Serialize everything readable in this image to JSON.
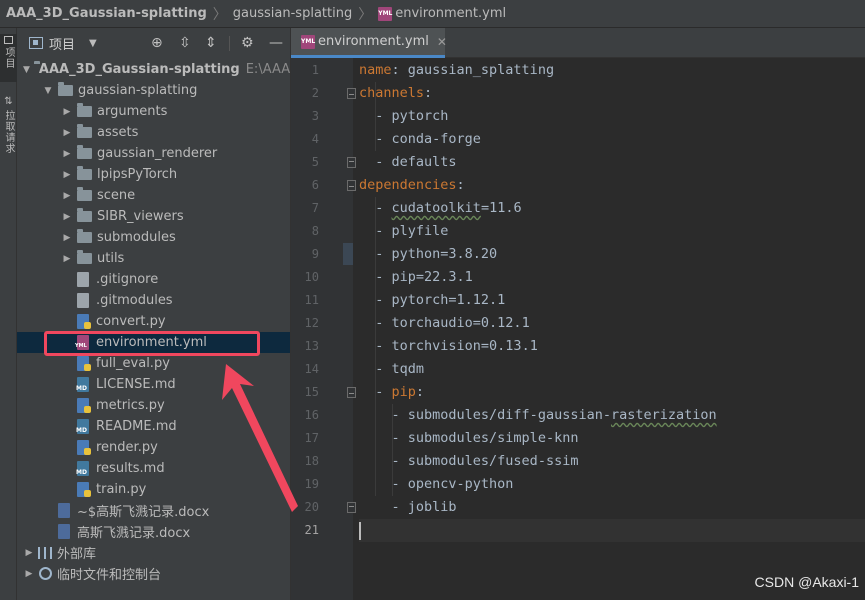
{
  "breadcrumb": {
    "root": "AAA_3D_Gaussian-splatting",
    "folder": "gaussian-splatting",
    "file": "environment.yml",
    "file_badge": "YML"
  },
  "toolstrip": {
    "project_tab": "项目",
    "pull_requests_tab": "拉取请求"
  },
  "project_panel": {
    "title": "项目",
    "toolbar_icons": [
      "target-icon",
      "expand-all-icon",
      "collapse-all-icon",
      "settings-icon",
      "hide-icon"
    ],
    "tree": [
      {
        "label": "AAA_3D_Gaussian-splatting",
        "hint": "E:\\AAA_",
        "type": "folder",
        "level": 0,
        "expanded": true
      },
      {
        "label": "gaussian-splatting",
        "type": "folder",
        "level": 1,
        "expanded": true
      },
      {
        "label": "arguments",
        "type": "folder",
        "level": 2
      },
      {
        "label": "assets",
        "type": "folder",
        "level": 2
      },
      {
        "label": "gaussian_renderer",
        "type": "folder",
        "level": 2
      },
      {
        "label": "lpipsPyTorch",
        "type": "folder",
        "level": 2
      },
      {
        "label": "scene",
        "type": "folder",
        "level": 2
      },
      {
        "label": "SIBR_viewers",
        "type": "folder",
        "level": 2
      },
      {
        "label": "submodules",
        "type": "folder",
        "level": 2
      },
      {
        "label": "utils",
        "type": "folder",
        "level": 2
      },
      {
        "label": ".gitignore",
        "type": "git",
        "level": 2
      },
      {
        "label": ".gitmodules",
        "type": "git",
        "level": 2
      },
      {
        "label": "convert.py",
        "type": "py",
        "level": 2
      },
      {
        "label": "environment.yml",
        "type": "yml",
        "level": 2,
        "selected": true
      },
      {
        "label": "full_eval.py",
        "type": "py",
        "level": 2
      },
      {
        "label": "LICENSE.md",
        "type": "md",
        "level": 2
      },
      {
        "label": "metrics.py",
        "type": "py",
        "level": 2
      },
      {
        "label": "README.md",
        "type": "md",
        "level": 2
      },
      {
        "label": "render.py",
        "type": "py",
        "level": 2
      },
      {
        "label": "results.md",
        "type": "md",
        "level": 2
      },
      {
        "label": "train.py",
        "type": "py",
        "level": 2
      },
      {
        "label": "~$高斯飞溅记录.docx",
        "type": "doc",
        "level": 1
      },
      {
        "label": "高斯飞溅记录.docx",
        "type": "doc",
        "level": 1
      },
      {
        "label": "外部库",
        "type": "libs",
        "level": 0
      },
      {
        "label": "临时文件和控制台",
        "type": "scratch",
        "level": 0
      }
    ]
  },
  "editor": {
    "tab_label": "environment.yml",
    "tab_badge": "YML",
    "current_line": 21,
    "lines": [
      {
        "n": "1",
        "indent": "",
        "key": "name",
        "rest": ": gaussian_splatting"
      },
      {
        "n": "2",
        "indent": "",
        "key": "channels",
        "rest": ":"
      },
      {
        "n": "3",
        "indent": "  ",
        "text": "- pytorch"
      },
      {
        "n": "4",
        "indent": "  ",
        "text": "- conda-forge"
      },
      {
        "n": "5",
        "indent": "  ",
        "text": "- defaults"
      },
      {
        "n": "6",
        "indent": "",
        "key": "dependencies",
        "rest": ":"
      },
      {
        "n": "7",
        "indent": "  ",
        "pre": "- ",
        "squig": "cudatoolkit",
        "post": "=11.6"
      },
      {
        "n": "8",
        "indent": "  ",
        "text": "- plyfile"
      },
      {
        "n": "9",
        "indent": "  ",
        "text": "- python=3.8.20"
      },
      {
        "n": "10",
        "indent": "  ",
        "text": "- pip=22.3.1"
      },
      {
        "n": "11",
        "indent": "  ",
        "text": "- pytorch=1.12.1"
      },
      {
        "n": "12",
        "indent": "  ",
        "text": "- torchaudio=0.12.1"
      },
      {
        "n": "13",
        "indent": "  ",
        "text": "- torchvision=0.13.1"
      },
      {
        "n": "14",
        "indent": "  ",
        "text": "- tqdm"
      },
      {
        "n": "15",
        "indent": "  ",
        "pre": "- ",
        "key": "pip",
        "rest": ":"
      },
      {
        "n": "16",
        "indent": "    ",
        "pre": "- submodules/diff-gaussian-",
        "squig": "rasterization",
        "post": ""
      },
      {
        "n": "17",
        "indent": "    ",
        "text": "- submodules/simple-knn"
      },
      {
        "n": "18",
        "indent": "    ",
        "text": "- submodules/fused-ssim"
      },
      {
        "n": "19",
        "indent": "    ",
        "text": "- opencv-python"
      },
      {
        "n": "20",
        "indent": "    ",
        "text": "- joblib"
      },
      {
        "n": "21",
        "indent": "",
        "text": ""
      }
    ]
  },
  "annotation": {
    "highlight_color": "#f0475e",
    "watermark": "CSDN @Akaxi-1"
  },
  "colors": {
    "yaml_key": "#cc7832",
    "code_text": "#a9b7c6",
    "panel_bg": "#3c3f41",
    "editor_bg": "#2b2b2b",
    "selection": "#0d293e"
  }
}
